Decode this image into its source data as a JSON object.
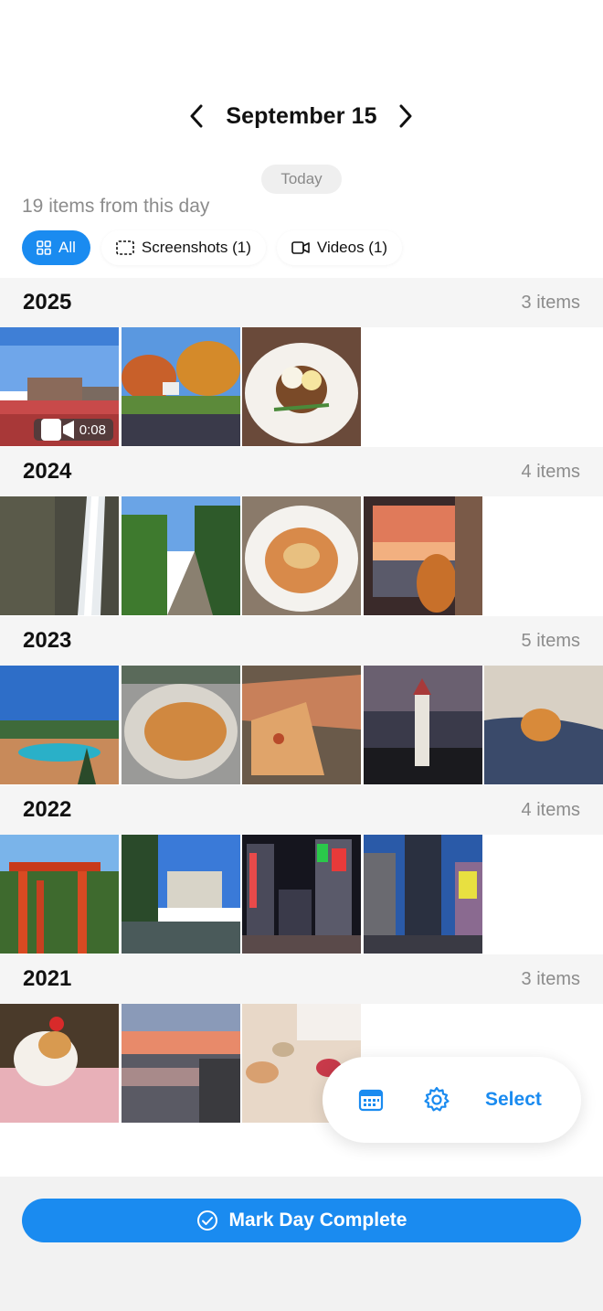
{
  "header": {
    "date_title": "September 15",
    "today_label": "Today"
  },
  "summary": "19 items from this day",
  "filters": [
    {
      "label": "All",
      "icon": "grid-icon",
      "active": true
    },
    {
      "label": "Screenshots (1)",
      "icon": "screenshot-icon",
      "active": false
    },
    {
      "label": "Videos (1)",
      "icon": "video-camera-icon",
      "active": false
    }
  ],
  "years": [
    {
      "year": "2025",
      "count": "3 items",
      "video_duration": "0:08"
    },
    {
      "year": "2024",
      "count": "4 items"
    },
    {
      "year": "2023",
      "count": "5 items"
    },
    {
      "year": "2022",
      "count": "4 items"
    },
    {
      "year": "2021",
      "count": "3 items"
    }
  ],
  "toolbar": {
    "select_label": "Select",
    "calendar_icon": "calendar-icon",
    "settings_icon": "gear-icon"
  },
  "footer": {
    "mark_complete_label": "Mark Day Complete"
  },
  "colors": {
    "accent": "#1a8bf0",
    "section_bg": "#f5f5f5",
    "muted_text": "#8c8c8c"
  }
}
